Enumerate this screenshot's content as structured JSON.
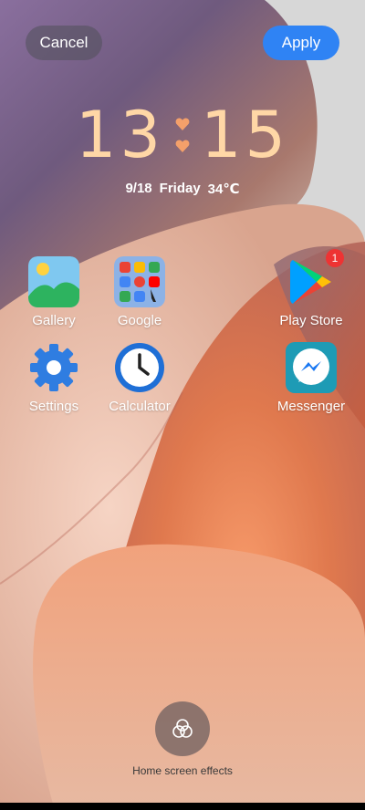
{
  "header": {
    "cancel_label": "Cancel",
    "apply_label": "Apply"
  },
  "clock": {
    "hours": "13",
    "minutes": "15"
  },
  "date": {
    "date": "9/18",
    "weekday": "Friday",
    "temperature": "34℃"
  },
  "apps": [
    {
      "label": "Gallery",
      "icon": "gallery-icon"
    },
    {
      "label": "Google",
      "icon": "google-folder-icon"
    },
    {
      "label": "Play Store",
      "icon": "play-store-icon",
      "badge": "1"
    },
    {
      "label": "Settings",
      "icon": "settings-gear-icon"
    },
    {
      "label": "Calculator",
      "icon": "clock-icon"
    },
    {
      "label": "Messenger",
      "icon": "messenger-icon"
    }
  ],
  "bottom": {
    "effects_label": "Home screen effects",
    "effects_icon": "effects-icon"
  },
  "colors": {
    "apply": "#2f83f4",
    "clock": "#ffd7a6",
    "badge": "#e33333"
  }
}
